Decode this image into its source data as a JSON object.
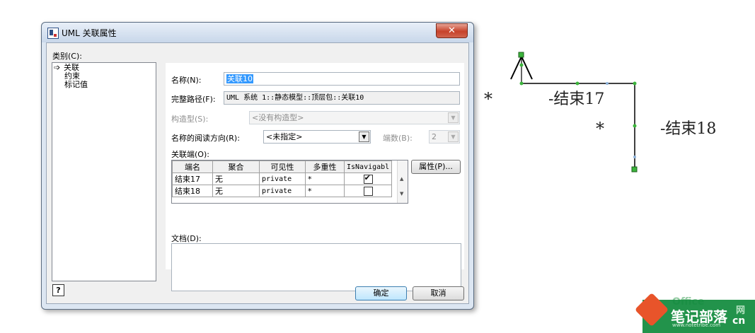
{
  "window": {
    "title": "UML 关联属性",
    "close_glyph": "✕"
  },
  "category": {
    "label": "类别(C):",
    "items": [
      "关联",
      "约束",
      "标记值"
    ],
    "selected_arrow": "➩"
  },
  "form": {
    "name_label": "名称(N):",
    "name_value": "关联10",
    "fullpath_label": "完整路径(F):",
    "fullpath_value": "UML 系统 1::静态模型::顶层包::关联10",
    "stereotype_label": "构造型(S):",
    "stereotype_value": "<没有构造型>",
    "direction_label": "名称的阅读方向(R):",
    "direction_value": "<未指定>",
    "endcount_label": "端数(B):",
    "endcount_value": "2",
    "ends_label": "关联端(O):",
    "doc_label": "文档(D):"
  },
  "ends_table": {
    "columns": [
      "端名",
      "聚合",
      "可见性",
      "多重性",
      "IsNavigabl"
    ],
    "rows": [
      {
        "name": "结束17",
        "aggregation": "无",
        "visibility": "private",
        "multiplicity": "*",
        "navigable": true
      },
      {
        "name": "结束18",
        "aggregation": "无",
        "visibility": "private",
        "multiplicity": "*",
        "navigable": false
      }
    ]
  },
  "buttons": {
    "properties": "属性(P)...",
    "ok": "确定",
    "cancel": "取消",
    "help": "?"
  },
  "diagram": {
    "end17_label": "-结束17",
    "end18_label": "-结束18",
    "multiplicity_left": "*",
    "multiplicity_right": "*"
  },
  "watermark": {
    "office_text": "Office",
    "brand_text": "笔记部落",
    "site_text": "www.notetribe.com",
    "net_text": "网",
    "cn_text": "cn"
  },
  "colors": {
    "selection": "#3399ff",
    "dialog_frame": "#dce6f2",
    "close_button": "#c7422a",
    "watermark_green": "#0f8a3c",
    "connector_green": "#3cb43c"
  }
}
